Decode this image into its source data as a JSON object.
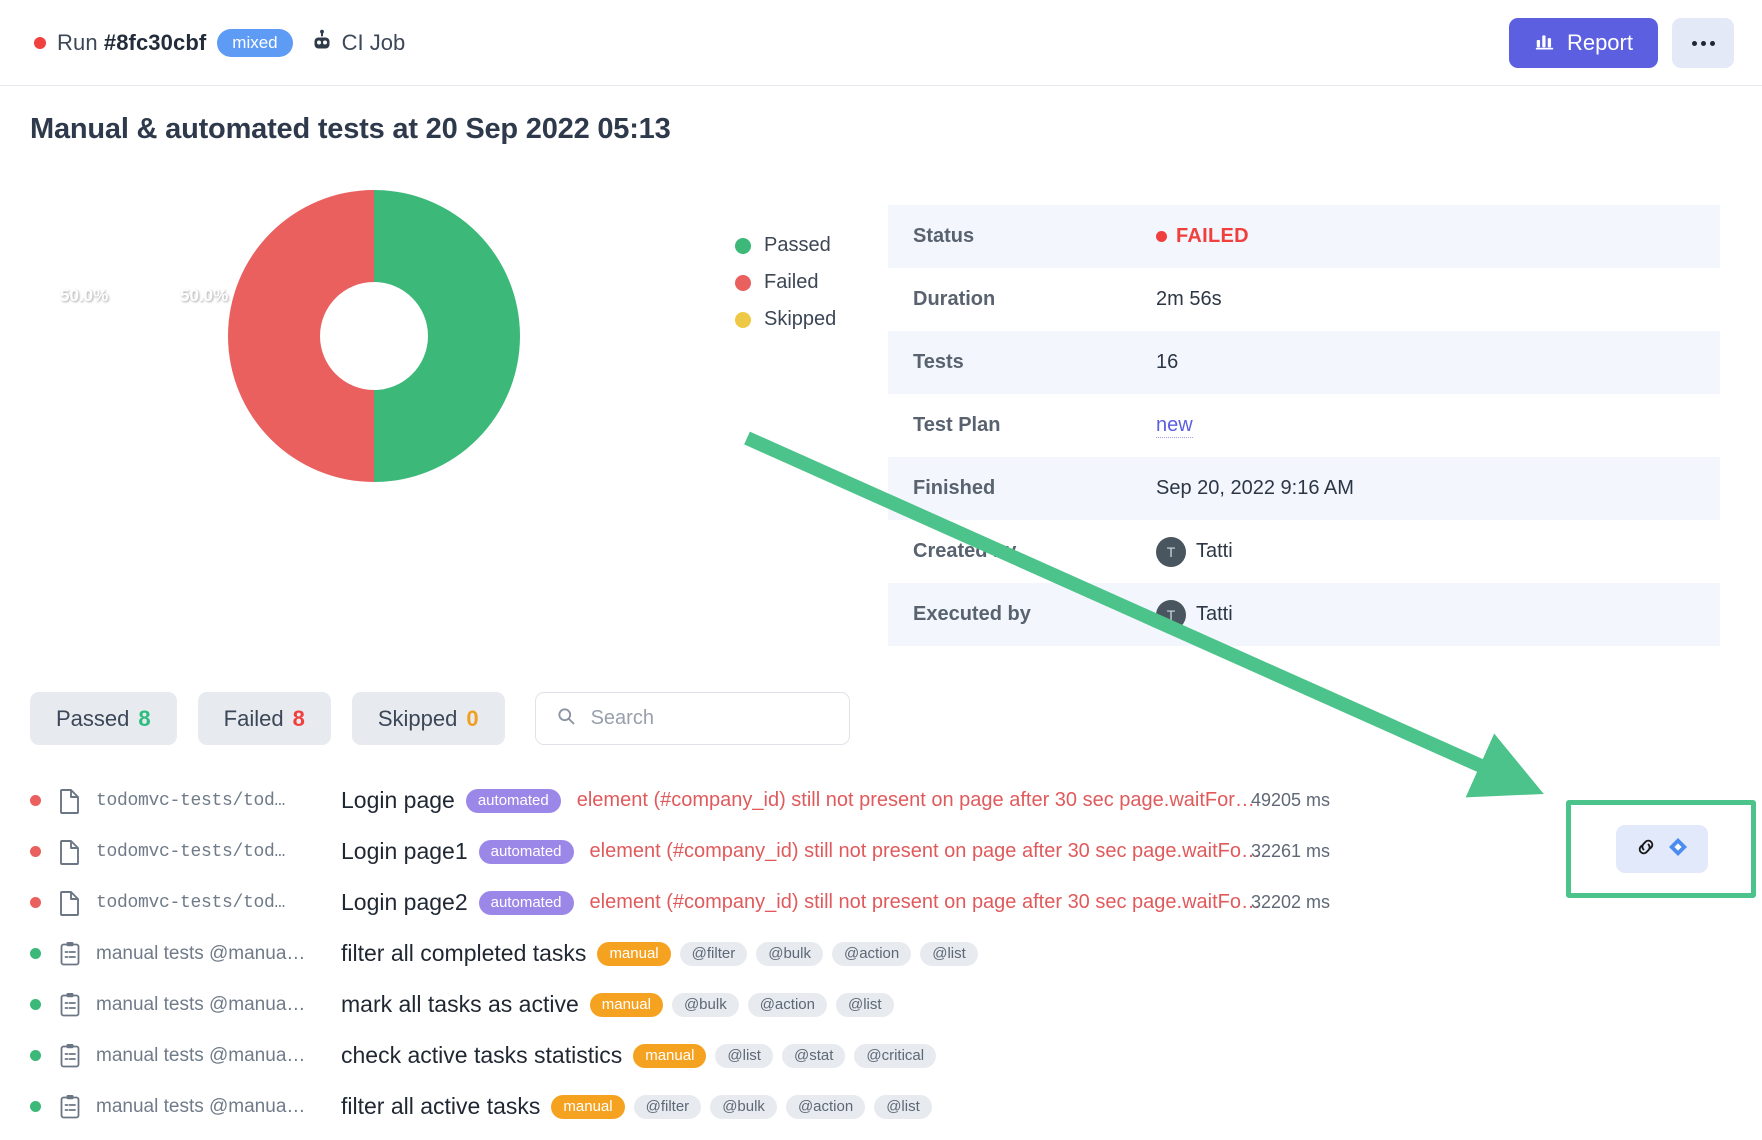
{
  "header": {
    "run_prefix": "Run ",
    "run_id": "#8fc30cbf",
    "badge": "mixed",
    "ci_label": "CI Job",
    "status_dot_color": "#f0413f",
    "report_button": "Report",
    "more_button": "...",
    "report_icon": "bar-chart-icon",
    "ci_icon": "robot-icon"
  },
  "page_title": "Manual & automated tests at 20 Sep 2022 05:13",
  "chart_data": {
    "type": "pie",
    "title": "",
    "categories": [
      "Passed",
      "Failed",
      "Skipped"
    ],
    "values": [
      50.0,
      50.0,
      0
    ],
    "labels": [
      "50.0%",
      "50.0%"
    ],
    "colors": [
      "#3cb878",
      "#e9605f",
      "#eec945"
    ],
    "legend_position": "right",
    "donut": true,
    "label_right": "50.0%",
    "label_left": "50.0%"
  },
  "legend": [
    {
      "label": "Passed",
      "color": "#3cb878"
    },
    {
      "label": "Failed",
      "color": "#e9605f"
    },
    {
      "label": "Skipped",
      "color": "#eec945"
    }
  ],
  "info": [
    {
      "key": "Status",
      "value": "FAILED",
      "type": "status"
    },
    {
      "key": "Duration",
      "value": "2m 56s",
      "type": "text"
    },
    {
      "key": "Tests",
      "value": "16",
      "type": "text"
    },
    {
      "key": "Test Plan",
      "value": "new",
      "type": "link"
    },
    {
      "key": "Finished",
      "value": "Sep 20, 2022 9:16 AM",
      "type": "text"
    },
    {
      "key": "Created by",
      "value": "Tatti",
      "avatar": "T",
      "type": "user"
    },
    {
      "key": "Executed by",
      "value": "Tatti",
      "avatar": "T",
      "type": "user"
    }
  ],
  "filters": [
    {
      "label": "Passed",
      "count": "8",
      "count_color": "#2bbd7e"
    },
    {
      "label": "Failed",
      "count": "8",
      "count_color": "#f0403e"
    },
    {
      "label": "Skipped",
      "count": "0",
      "count_color": "#f0a020"
    }
  ],
  "search": {
    "placeholder": "Search",
    "value": "",
    "icon": "search-icon"
  },
  "test_rows": [
    {
      "status": "failed",
      "icon": "file-icon",
      "mono": true,
      "path": "todomvc-tests/tod…",
      "name": "Login page",
      "tags": [
        {
          "label": "automated",
          "style": "automated"
        }
      ],
      "error": "element (#company_id) still not present on page after 30 sec page.waitFor…",
      "duration": "49205 ms"
    },
    {
      "status": "failed",
      "icon": "file-icon",
      "mono": true,
      "path": "todomvc-tests/tod…",
      "name": "Login page1",
      "tags": [
        {
          "label": "automated",
          "style": "automated"
        }
      ],
      "error": "element (#company_id) still not present on page after 30 sec page.waitFo…",
      "duration": "32261 ms"
    },
    {
      "status": "failed",
      "icon": "file-icon",
      "mono": true,
      "path": "todomvc-tests/tod…",
      "name": "Login page2",
      "tags": [
        {
          "label": "automated",
          "style": "automated"
        }
      ],
      "error": "element (#company_id) still not present on page after 30 sec page.waitFo…",
      "duration": "32202 ms"
    },
    {
      "status": "passed",
      "icon": "clipboard-icon",
      "mono": false,
      "path": "manual tests @manua…",
      "name": "filter all completed tasks",
      "tags": [
        {
          "label": "manual",
          "style": "manual"
        },
        {
          "label": "@filter",
          "style": "plain"
        },
        {
          "label": "@bulk",
          "style": "plain"
        },
        {
          "label": "@action",
          "style": "plain"
        },
        {
          "label": "@list",
          "style": "plain"
        }
      ],
      "error": "",
      "duration": ""
    },
    {
      "status": "passed",
      "icon": "clipboard-icon",
      "mono": false,
      "path": "manual tests @manua…",
      "name": "mark all tasks as active",
      "tags": [
        {
          "label": "manual",
          "style": "manual"
        },
        {
          "label": "@bulk",
          "style": "plain"
        },
        {
          "label": "@action",
          "style": "plain"
        },
        {
          "label": "@list",
          "style": "plain"
        }
      ],
      "error": "",
      "duration": ""
    },
    {
      "status": "passed",
      "icon": "clipboard-icon",
      "mono": false,
      "path": "manual tests @manua…",
      "name": "check active tasks statistics",
      "tags": [
        {
          "label": "manual",
          "style": "manual"
        },
        {
          "label": "@list",
          "style": "plain"
        },
        {
          "label": "@stat",
          "style": "plain"
        },
        {
          "label": "@critical",
          "style": "plain"
        }
      ],
      "error": "",
      "duration": ""
    },
    {
      "status": "passed",
      "icon": "clipboard-icon",
      "mono": false,
      "path": "manual tests @manua…",
      "name": "filter all active tasks",
      "tags": [
        {
          "label": "manual",
          "style": "manual"
        },
        {
          "label": "@filter",
          "style": "plain"
        },
        {
          "label": "@bulk",
          "style": "plain"
        },
        {
          "label": "@action",
          "style": "plain"
        },
        {
          "label": "@list",
          "style": "plain"
        }
      ],
      "error": "",
      "duration": ""
    }
  ],
  "annotation": {
    "arrow_color": "#4cc38a",
    "highlight_color": "#4cc38a",
    "action_icons": [
      "link-icon",
      "jira-icon"
    ]
  },
  "colors": {
    "accent": "#5b5fe0",
    "passed": "#3cb878",
    "failed": "#e9605f",
    "skipped": "#eec945",
    "badge_blue": "#5e9bf5"
  }
}
